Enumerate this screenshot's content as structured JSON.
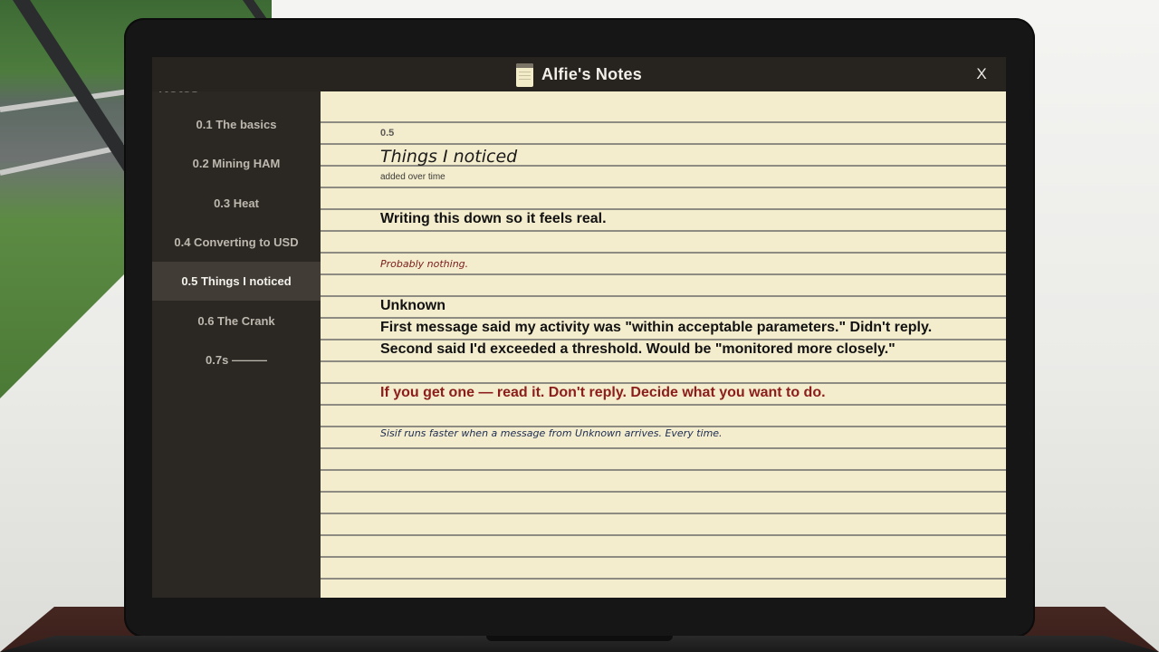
{
  "window": {
    "title": "Alfie's Notes",
    "close_label": "X"
  },
  "sidebar": {
    "heading": "Notes",
    "items": [
      {
        "label": "0.1 The basics",
        "active": false
      },
      {
        "label": "0.2 Mining HAM",
        "active": false
      },
      {
        "label": "0.3 Heat",
        "active": false
      },
      {
        "label": "0.4 Converting to USD",
        "active": false
      },
      {
        "label": "0.5 Things I noticed",
        "active": true
      },
      {
        "label": "0.6 The Crank",
        "active": false
      },
      {
        "label": "0.7s ———",
        "active": false
      }
    ]
  },
  "note": {
    "number": "0.5",
    "title": "Things I noticed",
    "subtitle": "added over time",
    "intro": "Writing this down so it feels real.",
    "aside": "Probably nothing.",
    "section_heading": "Unknown",
    "message_line_1": "First message said my activity was \"within acceptable parameters.\" Didn't reply.",
    "message_line_2": "Second said I'd exceeded a threshold. Would be \"monitored more closely.\"",
    "warning": "If you get one — read it. Don't reply. Decide what you want to do.",
    "footnote": "Sisif runs faster when a message from Unknown arrives. Every time."
  },
  "colors": {
    "paper": "#f3eccd",
    "sidebar_bg": "#2b2824",
    "active_item_bg": "#413c36",
    "warning_text": "#8b1d1a",
    "aside_text": "#7a1a1a",
    "footnote_text": "#1d2c52"
  },
  "icons": {
    "title_icon": "notepad-icon"
  }
}
